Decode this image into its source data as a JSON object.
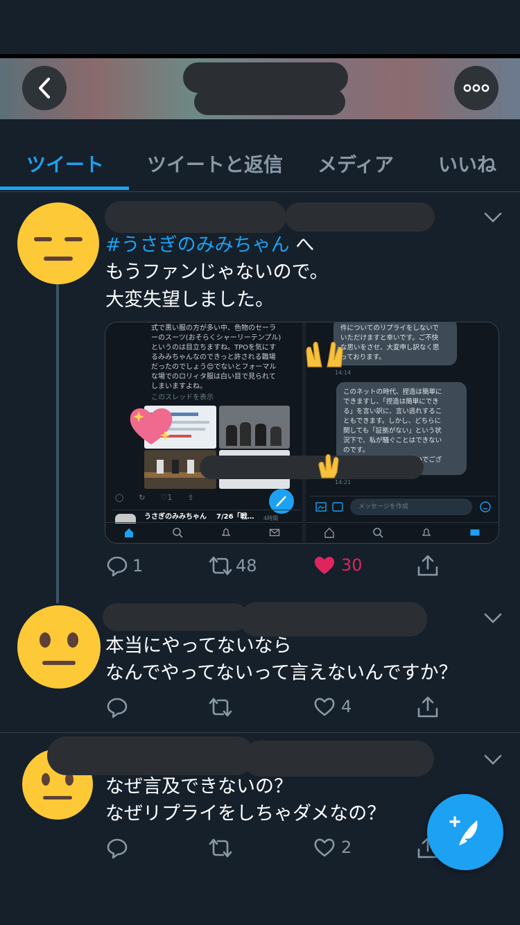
{
  "tabs": [
    "ツイート",
    "ツイートと返信",
    "メディア",
    "いいね"
  ],
  "tweets": [
    {
      "reply_prefix_hashtag": "#うさぎのみみちゃん",
      "reply_prefix_suffix": " へ",
      "lines": [
        "もうファンじゃないので。",
        "大変失望しました。"
      ],
      "replies": "1",
      "retweets": "48",
      "likes": "30",
      "liked": true
    },
    {
      "lines": [
        "本当にやってないなら",
        "なんでやってないって言えないんですか？"
      ],
      "replies": "",
      "retweets": "",
      "likes": "4",
      "liked": false
    },
    {
      "lines": [
        "なぜ言及できないの？",
        "なぜリプライをしちゃダメなの？"
      ],
      "replies": "",
      "retweets": "",
      "likes": "2",
      "liked": false
    }
  ],
  "media": {
    "left_text": "式で黒い服の方が多い中、色物のセーラ\nーのスーツ(おそらくシャーリーテンプル)\nというのは目立ちますね。TPOを気にす\nるみみちゃんなのできっと許される職場\nだったのでしょう😊でないとフォーマル\nな場でのロリィタ服は白い目で見られて\nしまいますよね。",
    "left_link": "このスレッドを表示",
    "left_bottom_name": "うさぎのみみちゃん",
    "left_bottom_date": "7/26「戦…",
    "left_bottom_time": "4時間",
    "bubble1": "件についてのリプライをしないで\nいただけますと幸いです。ご不快\nな思いをさせ、大変申し訳なく思\nっております。",
    "bubble1_time": "14:14",
    "bubble2": "このネットの時代、捏造は簡単に\nできますし、「捏造は簡単にでき\nる」を言い訳に、言い逃れするこ\nともできます。しかし、どちらに\n関しても「証拠がない」という状\n況下で、私が騒ぐことはできない\nのです。\nご理解いただけますと幸いでござ\nいます。",
    "bubble2_time": "14:21",
    "message_placeholder": "メッセージを作成"
  },
  "colors": {
    "background": "#15202b",
    "accent": "#1da1f2",
    "like": "#e0245e",
    "muted": "#8899a6"
  },
  "icons": {
    "back": "chevron-left-icon",
    "more": "more-dots-icon",
    "reply": "reply-icon",
    "retweet": "retweet-icon",
    "like": "heart-icon",
    "share": "share-icon",
    "compose": "compose-feather-icon"
  }
}
